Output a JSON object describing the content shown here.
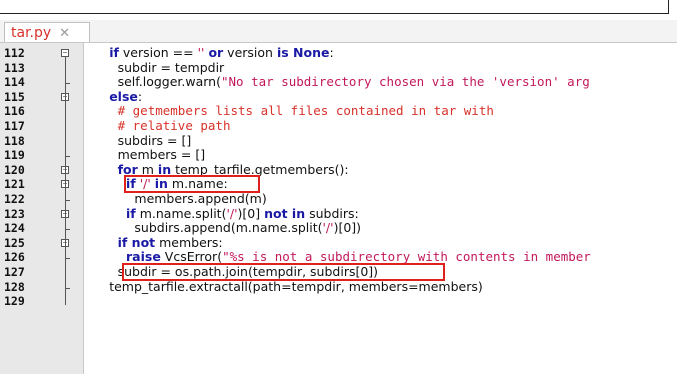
{
  "tab": {
    "label": "tar.py",
    "close_glyph": "✕"
  },
  "line_numbers": [
    "112",
    "113",
    "114",
    "115",
    "116",
    "117",
    "118",
    "119",
    "120",
    "121",
    "122",
    "123",
    "124",
    "125",
    "126",
    "127",
    "128",
    "129"
  ],
  "code_lines": [
    {
      "indent": 3,
      "tokens": [
        [
          "kw",
          "if"
        ],
        [
          "t",
          " version "
        ],
        [
          "t",
          "=="
        ],
        [
          "str",
          " '' "
        ],
        [
          "kw",
          "or"
        ],
        [
          "t",
          " version "
        ],
        [
          "kw",
          "is"
        ],
        [
          "kw",
          " None"
        ],
        [
          "t",
          ":"
        ]
      ]
    },
    {
      "indent": 4,
      "tokens": [
        [
          "t",
          "subdir = tempdir"
        ]
      ]
    },
    {
      "indent": 4,
      "tokens": [
        [
          "t",
          "self.logger.warn("
        ],
        [
          "str",
          "\"No tar subdirectory chosen via the 'version' arg"
        ]
      ]
    },
    {
      "indent": 3,
      "tokens": [
        [
          "kw",
          "else"
        ],
        [
          "t",
          ":"
        ]
      ]
    },
    {
      "indent": 4,
      "tokens": [
        [
          "cmt",
          "# getmembers lists all files contained in tar with"
        ]
      ]
    },
    {
      "indent": 4,
      "tokens": [
        [
          "cmt",
          "# relative path"
        ]
      ]
    },
    {
      "indent": 4,
      "tokens": [
        [
          "t",
          "subdirs = []"
        ]
      ]
    },
    {
      "indent": 4,
      "tokens": [
        [
          "t",
          "members = []"
        ]
      ]
    },
    {
      "indent": 4,
      "tokens": [
        [
          "kw",
          "for"
        ],
        [
          "t",
          " m "
        ],
        [
          "kw",
          "in"
        ],
        [
          "t",
          " temp_tarfile.getmembers():"
        ]
      ]
    },
    {
      "indent": 5,
      "tokens": [
        [
          "kw",
          "if"
        ],
        [
          "str",
          " '/' "
        ],
        [
          "kw",
          "in"
        ],
        [
          "t",
          " m.name:"
        ]
      ]
    },
    {
      "indent": 6,
      "tokens": [
        [
          "t",
          "members.append(m)"
        ]
      ]
    },
    {
      "indent": 5,
      "tokens": [
        [
          "kw",
          "if"
        ],
        [
          "t",
          " m.name.split("
        ],
        [
          "str",
          "'/'"
        ],
        [
          "t",
          ")[0] "
        ],
        [
          "kw",
          "not in"
        ],
        [
          "t",
          " subdirs:"
        ]
      ]
    },
    {
      "indent": 6,
      "tokens": [
        [
          "t",
          "subdirs.append(m.name.split("
        ],
        [
          "str",
          "'/'"
        ],
        [
          "t",
          ")[0])"
        ]
      ]
    },
    {
      "indent": 4,
      "tokens": [
        [
          "kw",
          "if not"
        ],
        [
          "t",
          " members:"
        ]
      ]
    },
    {
      "indent": 5,
      "tokens": [
        [
          "kw",
          "raise"
        ],
        [
          "t",
          " VcsError("
        ],
        [
          "str",
          "\"%s is not a subdirectory with contents in member"
        ]
      ]
    },
    {
      "indent": 4,
      "tokens": [
        [
          "t",
          "subdir = os.path.join(tempdir, subdirs[0])"
        ]
      ]
    },
    {
      "indent": 3,
      "tokens": [
        [
          "t",
          "temp_tarfile.extractall(path=tempdir, members=members)"
        ]
      ]
    },
    {
      "indent": 0,
      "tokens": [
        [
          "t",
          ""
        ]
      ]
    }
  ],
  "highlights": [
    {
      "label": "if '/' in m.name"
    },
    {
      "label": "subdir = os.path.join(tempdir, subdirs[0])"
    }
  ],
  "colors": {
    "keyword": "#1a1aa6",
    "string": "#c2185b",
    "comment": "#d8322a",
    "highlight_box": "#e0201a"
  }
}
